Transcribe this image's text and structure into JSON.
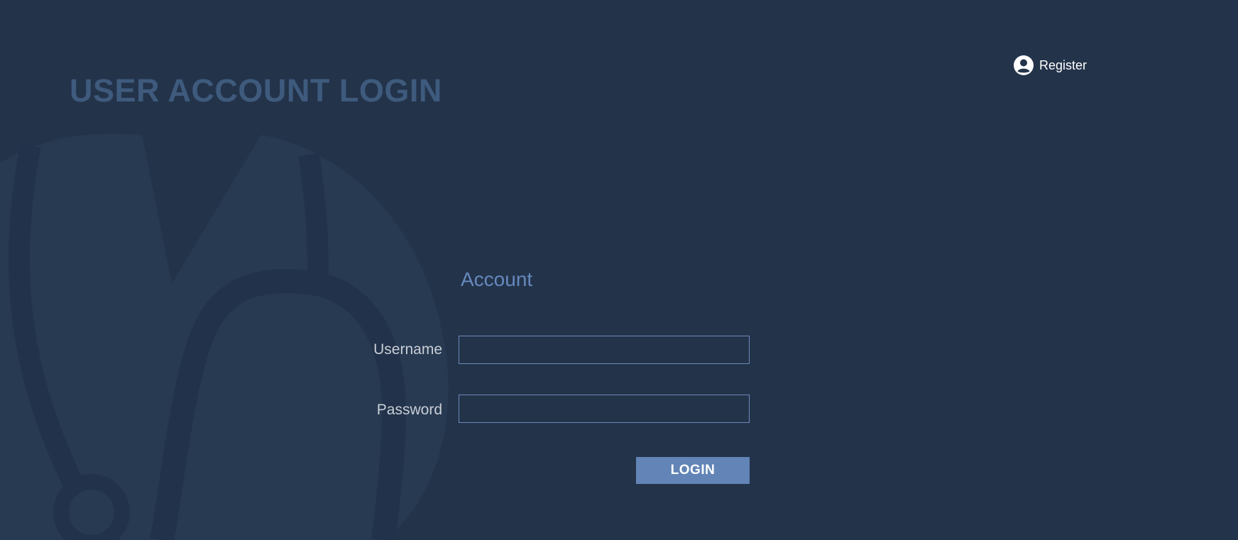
{
  "header": {
    "title": "USER ACCOUNT LOGIN",
    "register_label": "Register",
    "register_icon": "user-circle-icon"
  },
  "form": {
    "title": "Account",
    "username_label": "Username",
    "username_value": "",
    "password_label": "Password",
    "password_value": "",
    "login_label": "LOGIN"
  },
  "background": {
    "illustration": "stethoscope-silhouette"
  },
  "colors": {
    "background": "#23334a",
    "title": "#3e5a7d",
    "accent": "#6284b6",
    "form_title": "#6689bd",
    "label": "#c8ced6",
    "field_border": "#6b8bb7",
    "illustration": "#283a52"
  }
}
